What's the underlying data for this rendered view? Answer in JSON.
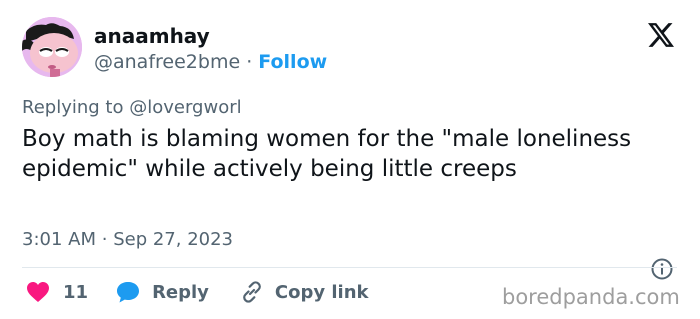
{
  "user": {
    "display_name": "anaamhay",
    "handle": "@anafree2bme",
    "separator": "·",
    "follow_label": "Follow"
  },
  "tweet": {
    "replying_prefix": "Replying to",
    "replying_to": "@lovergworl",
    "text": "Boy math is blaming women for the \"male loneliness epidemic\" while actively being little creeps",
    "time": "3:01 AM",
    "date": "Sep 27, 2023"
  },
  "actions": {
    "like_count": "11",
    "reply_label": "Reply",
    "copy_label": "Copy link"
  },
  "watermark": "boredpanda.com",
  "icons": {
    "logo": "x-logo-icon",
    "info": "info-icon",
    "like": "heart-icon",
    "reply": "speech-bubble-icon",
    "copy": "link-icon"
  },
  "colors": {
    "like": "#f91880",
    "reply": "#1d9bf0",
    "follow": "#1d9bf0",
    "muted": "#536471",
    "text": "#0f1419"
  }
}
